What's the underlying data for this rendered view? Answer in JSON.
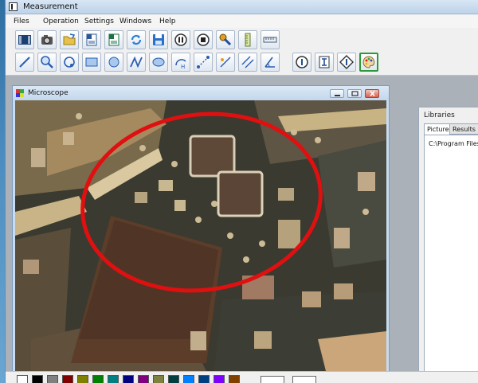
{
  "window": {
    "title": "Measurement"
  },
  "menu": [
    "Files",
    "Operation",
    "Settings",
    "Windows",
    "Help"
  ],
  "toolbar_row1": [
    {
      "name": "camera-view-icon"
    },
    {
      "name": "capture-icon"
    },
    {
      "name": "open-folder-icon"
    },
    {
      "name": "word-export-icon"
    },
    {
      "name": "excel-export-icon"
    },
    {
      "name": "refresh-icon"
    },
    {
      "name": "save-icon"
    },
    {
      "name": "pause-icon"
    },
    {
      "name": "stop-icon"
    },
    {
      "name": "wrench-settings-icon"
    },
    {
      "name": "vertical-ruler-icon"
    },
    {
      "name": "horizontal-ruler-icon"
    }
  ],
  "toolbar_row2": [
    {
      "name": "line-tool-icon"
    },
    {
      "name": "magnify-icon"
    },
    {
      "name": "circle-3pt-icon"
    },
    {
      "name": "rectangle-tool-icon"
    },
    {
      "name": "circle-tool-icon"
    },
    {
      "name": "polyline-tool-icon"
    },
    {
      "name": "ellipse-tool-icon"
    },
    {
      "name": "arc-tool-icon"
    },
    {
      "name": "distance-tool-icon"
    },
    {
      "name": "point-line-icon"
    },
    {
      "name": "parallel-distance-icon"
    },
    {
      "name": "angle-tool-icon"
    },
    {
      "name": "info-circle-icon"
    },
    {
      "name": "text-cursor-icon"
    },
    {
      "name": "diamond-info-icon"
    },
    {
      "name": "color-palette-icon"
    }
  ],
  "microscope": {
    "title": "Microscope"
  },
  "libraries": {
    "title": "Libraries",
    "tabs": [
      "Picture",
      "Results"
    ],
    "path": "C:\\Program Files (x"
  },
  "palette_colors": [
    "#ffffff",
    "#000000",
    "#808080",
    "#800000",
    "#808000",
    "#008000",
    "#008080",
    "#000080",
    "#800080",
    "#808040",
    "#004040",
    "#0080ff",
    "#004080",
    "#8000ff",
    "#804000"
  ],
  "colors": {
    "annotation": "#e01010"
  }
}
